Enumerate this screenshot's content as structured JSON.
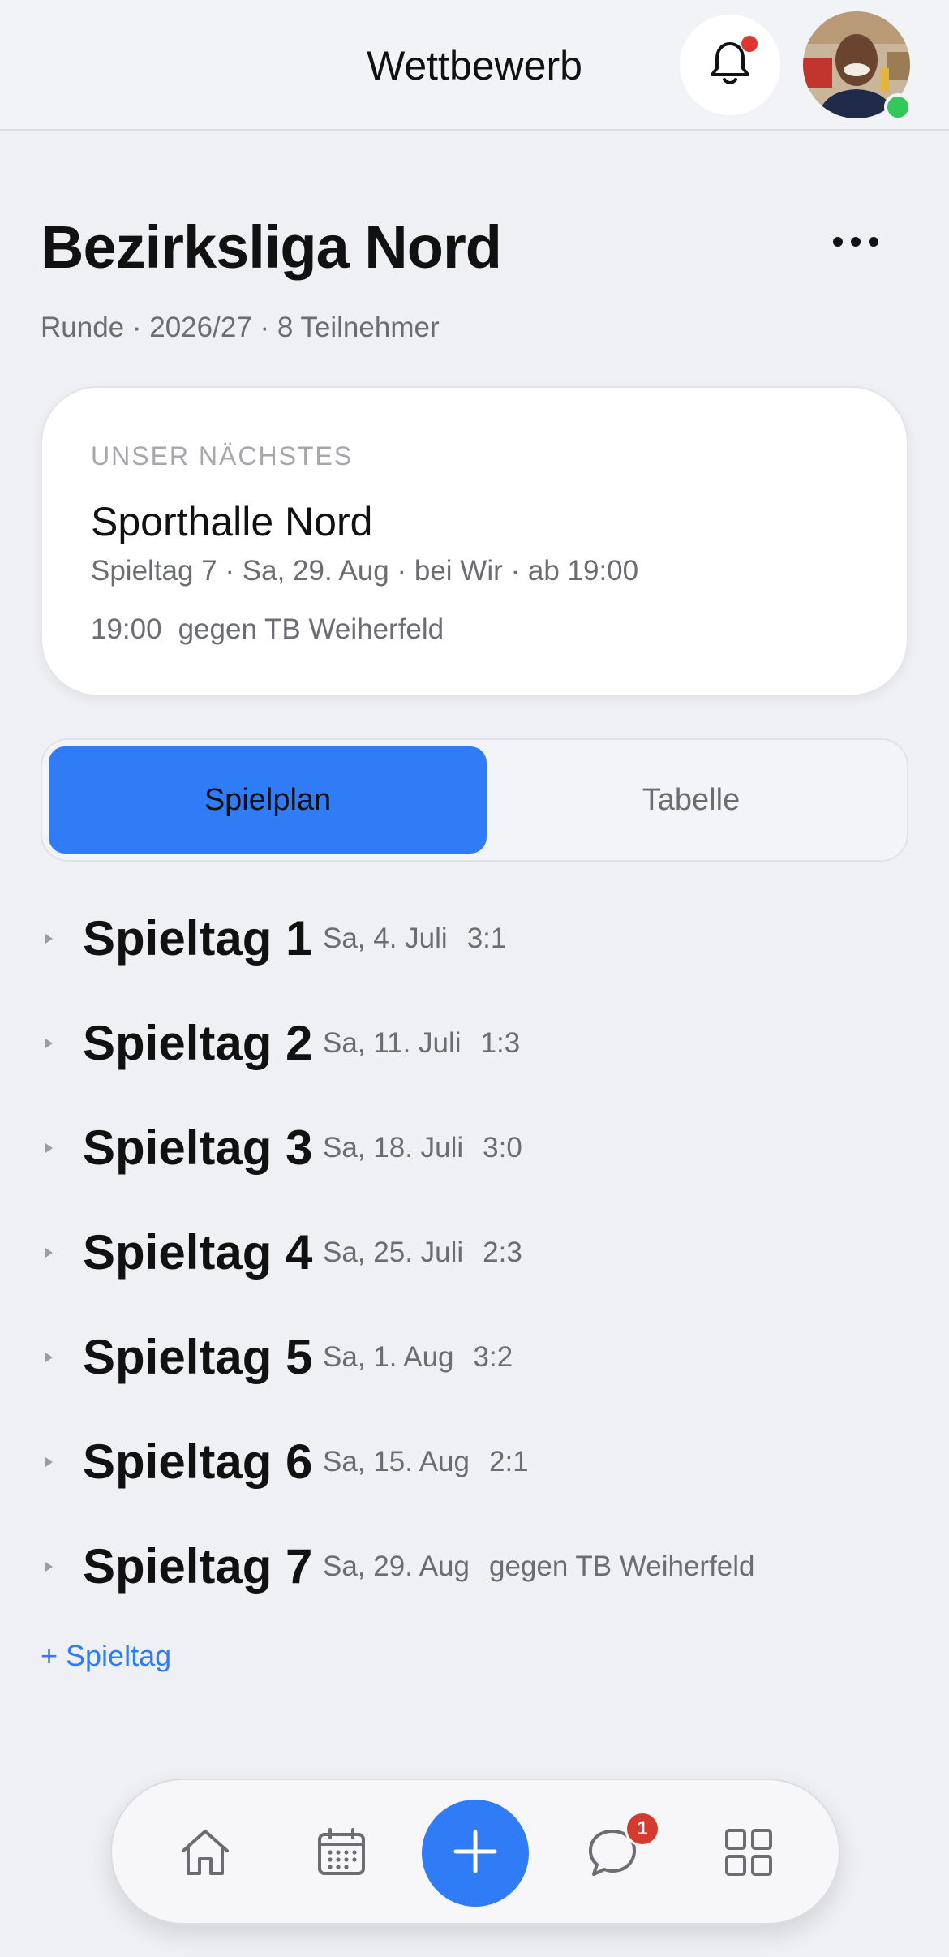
{
  "header": {
    "title": "Wettbewerb",
    "bell_icon": "bell-icon",
    "has_unread_notifications": true,
    "avatar_online": true
  },
  "competition": {
    "name": "Bezirksliga Nord",
    "subtitle": "Runde · 2026/27 · 8 Teilnehmer",
    "more_icon": "more-horizontal-icon"
  },
  "next_match": {
    "kicker": "UNSER NÄCHSTES",
    "venue": "Sporthalle Nord",
    "details": "Spieltag 7 · Sa, 29. Aug · bei Wir · ab 19:00",
    "time": "19:00",
    "opponent": "gegen TB Weiherfeld"
  },
  "tabs": {
    "schedule": "Spielplan",
    "table": "Tabelle",
    "active": "schedule"
  },
  "rounds": [
    {
      "name": "Spieltag 1",
      "date": "Sa, 4. Juli",
      "result": "3:1"
    },
    {
      "name": "Spieltag 2",
      "date": "Sa, 11. Juli",
      "result": "1:3"
    },
    {
      "name": "Spieltag 3",
      "date": "Sa, 18. Juli",
      "result": "3:0"
    },
    {
      "name": "Spieltag 4",
      "date": "Sa, 25. Juli",
      "result": "2:3"
    },
    {
      "name": "Spieltag 5",
      "date": "Sa, 1. Aug",
      "result": "3:2"
    },
    {
      "name": "Spieltag 6",
      "date": "Sa, 15. Aug",
      "result": "2:1"
    },
    {
      "name": "Spieltag 7",
      "date": "Sa, 29. Aug",
      "result": "gegen TB Weiherfeld"
    }
  ],
  "add_round": "+ Spieltag",
  "tabbar": {
    "items": [
      "home-icon",
      "calendar-icon",
      "plus-icon",
      "chat-icon",
      "grid-icon"
    ],
    "chat_badge": "1"
  },
  "colors": {
    "accent": "#2f7cf6",
    "background": "#eff0f4",
    "badge": "#d63a2e",
    "online": "#34c759"
  }
}
